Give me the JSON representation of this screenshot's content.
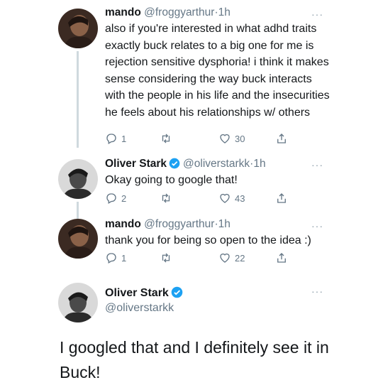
{
  "tweets": [
    {
      "author": "mando",
      "handle": "@froggyarthur",
      "sep": "·",
      "time": "1h",
      "verified": false,
      "text": "also if you're interested in what adhd traits exactly buck relates to a big one for me is rejection sensitive dysphoria! i think it makes sense considering the way buck interacts with the people in his life and the insecurities he feels about his relationships w/ others",
      "replies": "1",
      "retweets": "",
      "likes": "30"
    },
    {
      "author": "Oliver Stark",
      "handle": "@oliverstarkk",
      "sep": "·",
      "time": "1h",
      "verified": true,
      "text": "Okay going to google that!",
      "replies": "2",
      "retweets": "",
      "likes": "43"
    },
    {
      "author": "mando",
      "handle": "@froggyarthur",
      "sep": "·",
      "time": "1h",
      "verified": false,
      "text": "thank you for being so open to the idea :)",
      "replies": "1",
      "retweets": "",
      "likes": "22"
    }
  ],
  "main_tweet": {
    "author": "Oliver Stark",
    "handle": "@oliverstarkk",
    "verified": true,
    "text": "I googled that and I definitely see it in Buck!"
  },
  "more_label": "···",
  "colors": {
    "verified": "#1da1f2",
    "icon": "#657786",
    "thread_line": "#cfd9de"
  }
}
